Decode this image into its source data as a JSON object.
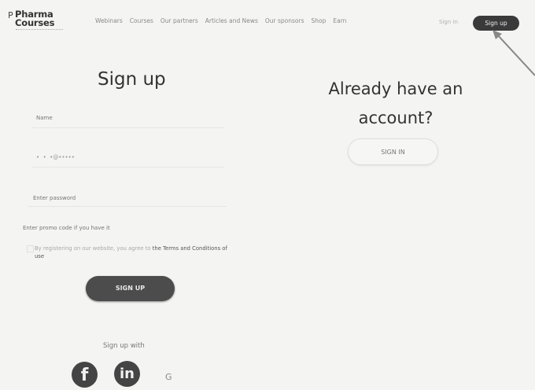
{
  "header": {
    "logo_mark": "P",
    "logo_line1": "Pharma",
    "logo_line2": "Courses",
    "nav": [
      "Webinars",
      "Courses",
      "Our partners",
      "Articles and News",
      "Our sponsors",
      "Shop",
      "Earn"
    ],
    "signin_label": "Sign in",
    "signup_label": "Sign up"
  },
  "signup_form": {
    "title": "Sign up",
    "name_placeholder": "Name",
    "email_value": "•  •  •@•••••",
    "password_placeholder": "Enter password",
    "promo_placeholder": "Enter promo code if you have it",
    "terms_text": "By registering on our website, you agree to ",
    "terms_link": "the Terms and Conditions of use",
    "submit_label": "SIGN UP",
    "social_label": "Sign up with",
    "facebook_glyph": "f",
    "linkedin_glyph": "in",
    "google_glyph": "G"
  },
  "signin_panel": {
    "title": "Already have an account?",
    "button_label": "SIGN IN"
  },
  "icons": [
    "facebook-icon",
    "linkedin-icon",
    "google-icon",
    "arrow-annotation-icon"
  ],
  "colors": {
    "accent_dark": "#3a3a3a",
    "background": "#f4f4f2"
  }
}
